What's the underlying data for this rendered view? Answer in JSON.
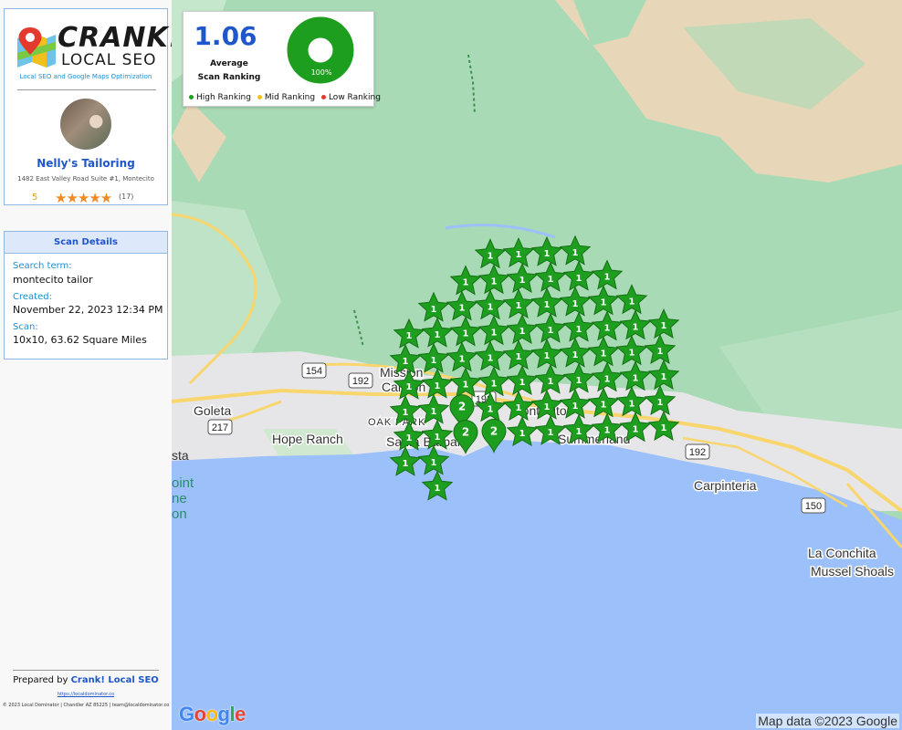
{
  "brand": {
    "logo_line1": "CRANK!",
    "logo_line2": "LOCAL SEO",
    "tagline": "Local SEO and Google Maps Optimization"
  },
  "business": {
    "name": "Nelly's Tailoring",
    "address": "1482 East Valley Road Suite #1, Montecito",
    "rating": "5",
    "stars": "★★★★★",
    "review_count": "(17)"
  },
  "scan_details": {
    "title": "Scan Details",
    "search_term_label": "Search term:",
    "search_term": "montecito tailor",
    "created_label": "Created:",
    "created": "November 22, 2023 12:34 PM",
    "scan_label": "Scan:",
    "scan": "10x10, 63.62 Square Miles"
  },
  "footer": {
    "prepared_by_prefix": "Prepared by ",
    "prepared_by_name": "Crank! Local SEO",
    "url": "https://localdominator.co",
    "legal": "© 2023 Local Dominator | Chandler AZ 85225 | team@localdominator.co"
  },
  "summary": {
    "average": "1.06",
    "average_label_1": "Average",
    "average_label_2": "Scan Ranking",
    "percent_label": "100%",
    "high_share": 1.0,
    "legend": [
      {
        "label": "High Ranking",
        "color": "#1e9e1e"
      },
      {
        "label": "Mid Ranking",
        "color": "#f2c01c"
      },
      {
        "label": "Low Ranking",
        "color": "#e23a2c"
      }
    ]
  },
  "map": {
    "labels": [
      {
        "text": "Goleta"
      },
      {
        "text": "Hope Ranch"
      },
      {
        "text": "Mission"
      },
      {
        "text": "Canyon"
      },
      {
        "text": "OAK PARK"
      },
      {
        "text": "Santa Barbara"
      },
      {
        "text": "Montecito"
      },
      {
        "text": "Summerland"
      },
      {
        "text": "Carpinteria"
      },
      {
        "text": "La Conchita"
      },
      {
        "text": "Mussel Shoals"
      },
      {
        "text": "sta"
      },
      {
        "text": "oint"
      },
      {
        "text": "ne"
      },
      {
        "text": "on"
      }
    ],
    "route_shields": [
      "154",
      "192",
      "217",
      "192",
      "192",
      "150"
    ],
    "attribution": "Map data ©2023 Google",
    "google_logo": "Google",
    "pin_color": "#1e9e1e",
    "grid_ranks": [
      [
        null,
        null,
        null,
        "1",
        "1",
        "1",
        "1",
        null,
        null,
        null
      ],
      [
        null,
        null,
        "1",
        "1",
        "1",
        "1",
        "1",
        "1",
        null,
        null
      ],
      [
        null,
        "1",
        "1",
        "1",
        "1",
        "1",
        "1",
        "1",
        "1",
        null
      ],
      [
        "1",
        "1",
        "1",
        "1",
        "1",
        "1",
        "1",
        "1",
        "1",
        "1"
      ],
      [
        "1",
        "1",
        "1",
        "1",
        "1",
        "1",
        "1",
        "1",
        "1",
        "1"
      ],
      [
        "1",
        "1",
        "1",
        "1",
        "1",
        "1",
        "1",
        "1",
        "1",
        "1"
      ],
      [
        "1",
        "1",
        "2",
        "1",
        "1",
        "1",
        "1",
        "1",
        "1",
        "1"
      ],
      [
        "1",
        "1",
        "2",
        "2",
        "1",
        "1",
        "1",
        "1",
        "1",
        "1"
      ],
      [
        "1",
        "1",
        null,
        null,
        null,
        null,
        null,
        null,
        null,
        null
      ],
      [
        null,
        "1",
        null,
        null,
        null,
        null,
        null,
        null,
        null,
        null
      ]
    ]
  }
}
